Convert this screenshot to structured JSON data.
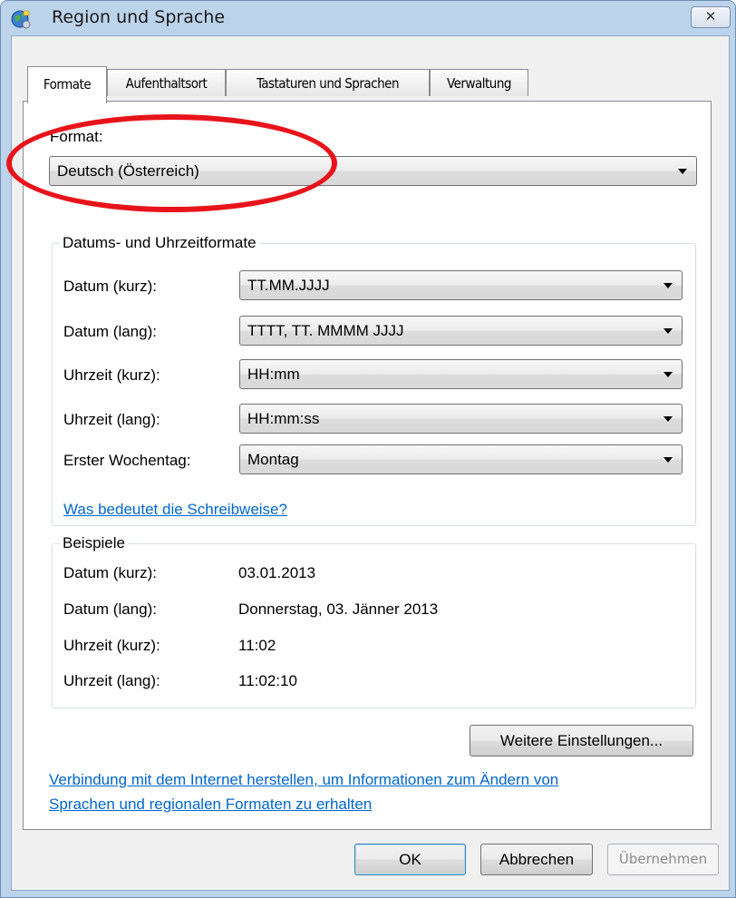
{
  "window": {
    "title": "Region und Sprache",
    "close_symbol": "✕"
  },
  "tabs": [
    "Formate",
    "Aufenthaltsort",
    "Tastaturen und Sprachen",
    "Verwaltung"
  ],
  "format": {
    "label": "Format:",
    "value": "Deutsch (Österreich)"
  },
  "datetime_group": {
    "title": "Datums- und Uhrzeitformate",
    "rows": [
      {
        "label": "Datum (kurz):",
        "value": "TT.MM.JJJJ"
      },
      {
        "label": "Datum (lang):",
        "value": "TTTT, TT. MMMM JJJJ"
      },
      {
        "label": "Uhrzeit (kurz):",
        "value": "HH:mm"
      },
      {
        "label": "Uhrzeit (lang):",
        "value": "HH:mm:ss"
      },
      {
        "label": "Erster Wochentag:",
        "value": "Montag"
      }
    ],
    "help_link": "Was bedeutet die Schreibweise?"
  },
  "examples_group": {
    "title": "Beispiele",
    "rows": [
      {
        "label": "Datum (kurz):",
        "value": "03.01.2013"
      },
      {
        "label": "Datum (lang):",
        "value": "Donnerstag, 03. Jänner 2013"
      },
      {
        "label": "Uhrzeit (kurz):",
        "value": "11:02"
      },
      {
        "label": "Uhrzeit (lang):",
        "value": "11:02:10"
      }
    ]
  },
  "more_settings_button": "Weitere Einstellungen...",
  "internet_link": {
    "line1": "Verbindung mit dem Internet herstellen, um Informationen zum Ändern von",
    "line2": "Sprachen und regionalen Formaten zu erhalten"
  },
  "buttons": {
    "ok": "OK",
    "cancel": "Abbrechen",
    "apply": "Übernehmen"
  },
  "colors": {
    "accent_link": "#0066cc",
    "highlight": "#e8141b",
    "frame": "#bcd3ec"
  }
}
